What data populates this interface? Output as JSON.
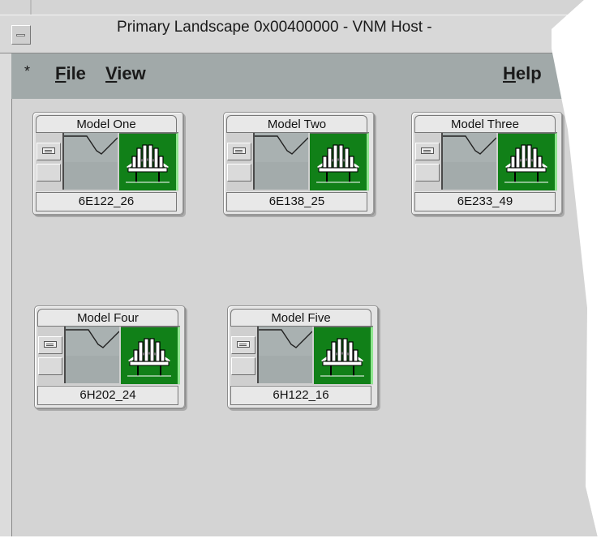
{
  "window": {
    "title": "Primary Landscape 0x00400000 - VNM Host -"
  },
  "menu": {
    "star": "*",
    "file_mnemonic": "F",
    "file_rest": "ile",
    "view_mnemonic": "V",
    "view_rest": "iew",
    "help_mnemonic": "H",
    "help_rest": "elp"
  },
  "models": [
    {
      "name": "Model One",
      "label": "6E122_26"
    },
    {
      "name": "Model Two",
      "label": "6E138_25"
    },
    {
      "name": "Model Three",
      "label": "6E233_49"
    },
    {
      "name": "Model Four",
      "label": "6H202_24"
    },
    {
      "name": "Model Five",
      "label": "6H122_16"
    }
  ],
  "colors": {
    "status_ok": "#118018",
    "menu_bar": "#a1a9a9",
    "workspace": "#d4d4d4"
  },
  "icons": {
    "status": "bridge-icon",
    "graph": "trend-graph-icon"
  }
}
